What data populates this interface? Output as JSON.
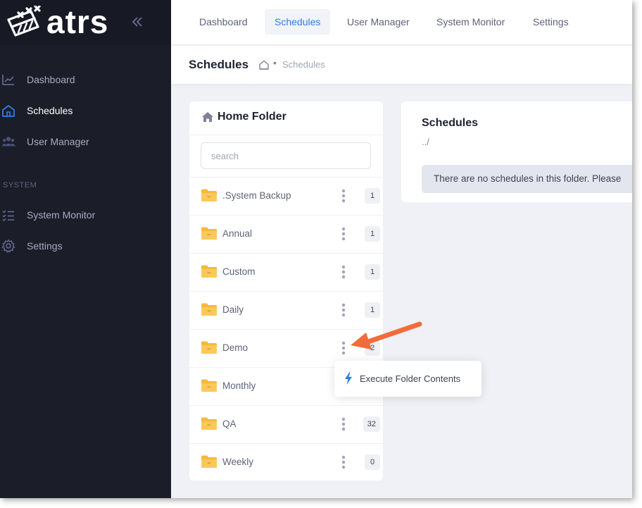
{
  "app": {
    "logo_text": "atrs",
    "collapse_icon": "double-chevron-left-icon"
  },
  "sidebar": {
    "items": [
      {
        "label": "Dashboard",
        "icon": "chart-line-icon",
        "active": false
      },
      {
        "label": "Schedules",
        "icon": "home-icon",
        "active": true
      },
      {
        "label": "User Manager",
        "icon": "users-icon",
        "active": false
      }
    ],
    "section_label": "SYSTEM",
    "system_items": [
      {
        "label": "System Monitor",
        "icon": "checklist-icon"
      },
      {
        "label": "Settings",
        "icon": "gear-icon"
      }
    ]
  },
  "topnav": {
    "tabs": [
      {
        "label": "Dashboard",
        "active": false
      },
      {
        "label": "Schedules",
        "active": true
      },
      {
        "label": "User Manager",
        "active": false
      },
      {
        "label": "System Monitor",
        "active": false
      },
      {
        "label": "Settings",
        "active": false
      }
    ]
  },
  "toolbar": {
    "title": "Schedules",
    "breadcrumb_separator": "•",
    "breadcrumb_current": "Schedules"
  },
  "folders": {
    "title": "Home Folder",
    "search_placeholder": "search",
    "items": [
      {
        "name": ".System Backup",
        "count": "1"
      },
      {
        "name": "Annual",
        "count": "1"
      },
      {
        "name": "Custom",
        "count": "1"
      },
      {
        "name": "Daily",
        "count": "1"
      },
      {
        "name": "Demo",
        "count": "2"
      },
      {
        "name": "Monthly",
        "count": ""
      },
      {
        "name": "QA",
        "count": "32"
      },
      {
        "name": "Weekly",
        "count": "0"
      }
    ]
  },
  "context_menu": {
    "item_label": "Execute Folder Contents",
    "item_icon": "lightning-bolt-icon"
  },
  "schedules": {
    "title": "Schedules",
    "path": "../",
    "empty_message": "There are no schedules in this folder. Please"
  },
  "colors": {
    "sidebar_bg": "#1b1d29",
    "accent": "#2f7ee6",
    "folder": "#f6b93b",
    "annotation": "#f26b3a"
  }
}
